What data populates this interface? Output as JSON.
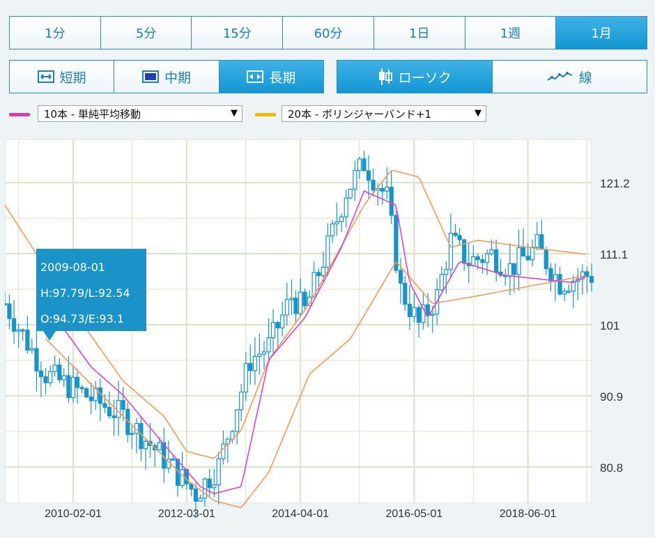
{
  "timeframes": [
    {
      "label": "1分",
      "active": false
    },
    {
      "label": "5分",
      "active": false
    },
    {
      "label": "15分",
      "active": false
    },
    {
      "label": "60分",
      "active": false
    },
    {
      "label": "1日",
      "active": false
    },
    {
      "label": "1週",
      "active": false
    },
    {
      "label": "1月",
      "active": true
    }
  ],
  "range_buttons": [
    {
      "label": "短期",
      "icon": "arrows-horizontal-icon",
      "active": false
    },
    {
      "label": "中期",
      "icon": "square-icon",
      "active": false
    },
    {
      "label": "長期",
      "icon": "arrows-outward-icon",
      "active": true
    }
  ],
  "style_buttons": [
    {
      "label": "ローソク",
      "icon": "candlestick-icon",
      "active": true
    },
    {
      "label": "線",
      "icon": "line-chart-icon",
      "active": false
    }
  ],
  "indicators": [
    {
      "label": "10本 - 単純平均移動",
      "color": "#d63fa8"
    },
    {
      "label": "20本 - ボリンジャーバンド+1",
      "color": "#f5b800"
    }
  ],
  "tooltip": {
    "date": "2009-08-01",
    "hl": "H:97.79/L:92.54",
    "oe": "O:94.73/E:93.1"
  },
  "colors": {
    "accent": "#1b93c9",
    "candle": "#1a93c6",
    "sma": "#e040d0",
    "bollinger": "#f39a5a",
    "grid": "#d9e3c8"
  },
  "chart_data": {
    "type": "candlestick",
    "x_ticks": [
      "2010-02-01",
      "2012-03-01",
      "2014-04-01",
      "2016-05-01",
      "2018-06-01"
    ],
    "y_ticks": [
      80.8,
      90.9,
      101,
      111.1,
      121.2
    ],
    "ylim": [
      74.4,
      100.0
    ],
    "grid": true,
    "series": [
      {
        "name": "10本 - 単純平均移動",
        "type": "line",
        "x": [
          "2009-08-01",
          "2010-06-01",
          "2011-01-01",
          "2011-10-01",
          "2012-06-01",
          "2012-09-01",
          "2013-03-01",
          "2013-09-01",
          "2014-05-01",
          "2015-01-01",
          "2015-06-01",
          "2016-01-01",
          "2016-04-01",
          "2016-08-01",
          "2017-03-01",
          "2018-01-01",
          "2019-04-01",
          "2019-07-01"
        ],
        "values": [
          104,
          95,
          91,
          84,
          78,
          77,
          78,
          96,
          102,
          112,
          120,
          118,
          107,
          102,
          110,
          108,
          107,
          108
        ]
      },
      {
        "name": "20本 - ボリンジャーバンド+1 (upper)",
        "type": "line",
        "x": [
          "2008-11-01",
          "2010-02-01",
          "2011-01-01",
          "2011-10-01",
          "2012-03-01",
          "2012-09-01",
          "2013-03-01",
          "2013-09-01",
          "2014-06-01",
          "2015-06-01",
          "2015-12-01",
          "2016-06-01",
          "2017-01-01",
          "2017-07-01",
          "2018-06-01",
          "2019-07-01"
        ],
        "values": [
          118,
          103,
          93,
          88,
          83,
          82,
          86,
          96,
          104,
          118,
          123,
          122,
          112,
          113,
          112,
          111
        ]
      },
      {
        "name": "20本 - ボリンジャーバンド+1 (lower)",
        "type": "line",
        "x": [
          "2009-08-01",
          "2011-01-01",
          "2012-03-01",
          "2012-09-01",
          "2013-03-01",
          "2013-09-01",
          "2014-06-01",
          "2015-03-01",
          "2016-01-01",
          "2016-09-01",
          "2017-06-01",
          "2019-07-01"
        ],
        "values": [
          99,
          88,
          79,
          76,
          75,
          80,
          94,
          99,
          110,
          104,
          105,
          108
        ]
      }
    ],
    "candles": [
      {
        "x": "2009-08-01",
        "o": 94.73,
        "h": 97.79,
        "l": 92.54,
        "c": 93.1
      }
    ],
    "candle_path": {
      "x": [
        "2008-11-01",
        "2009-08-01",
        "2010-02-01",
        "2011-01-01",
        "2011-10-01",
        "2012-05-01",
        "2012-10-01",
        "2013-05-01",
        "2013-09-01",
        "2014-02-01",
        "2014-05-01",
        "2014-10-01",
        "2015-02-01",
        "2015-06-01",
        "2015-11-01",
        "2016-02-01",
        "2016-06-01",
        "2016-10-01",
        "2017-01-01",
        "2017-05-01",
        "2017-10-01",
        "2018-02-01",
        "2018-08-01",
        "2019-01-01",
        "2019-07-01"
      ],
      "values": [
        104,
        94,
        92,
        88,
        82,
        77,
        81,
        96,
        98,
        105,
        103,
        112,
        120,
        124,
        119,
        106,
        101,
        105,
        113,
        110,
        111,
        109,
        112,
        107,
        108
      ]
    }
  }
}
